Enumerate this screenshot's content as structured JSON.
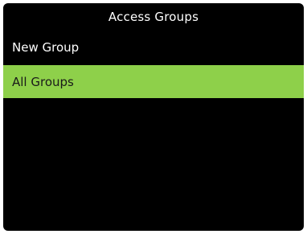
{
  "window": {
    "title": "Access Groups"
  },
  "menu": {
    "items": [
      {
        "label": "New Group",
        "selected": false
      },
      {
        "label": "All Groups",
        "selected": true
      }
    ]
  },
  "colors": {
    "background": "#000000",
    "text": "#ffffff",
    "selected_background": "#8ed04a",
    "selected_text": "#1a1a1a"
  }
}
